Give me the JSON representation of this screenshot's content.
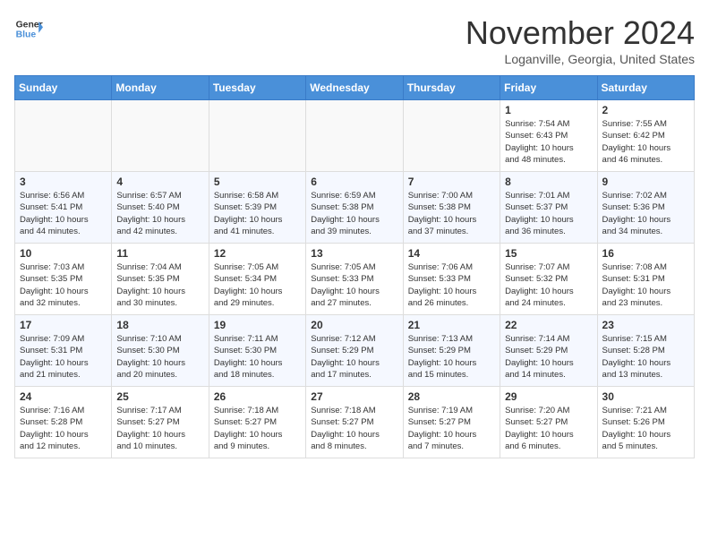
{
  "header": {
    "logo_line1": "General",
    "logo_line2": "Blue",
    "month": "November 2024",
    "location": "Loganville, Georgia, United States"
  },
  "weekdays": [
    "Sunday",
    "Monday",
    "Tuesday",
    "Wednesday",
    "Thursday",
    "Friday",
    "Saturday"
  ],
  "weeks": [
    [
      {
        "day": "",
        "info": ""
      },
      {
        "day": "",
        "info": ""
      },
      {
        "day": "",
        "info": ""
      },
      {
        "day": "",
        "info": ""
      },
      {
        "day": "",
        "info": ""
      },
      {
        "day": "1",
        "info": "Sunrise: 7:54 AM\nSunset: 6:43 PM\nDaylight: 10 hours\nand 48 minutes."
      },
      {
        "day": "2",
        "info": "Sunrise: 7:55 AM\nSunset: 6:42 PM\nDaylight: 10 hours\nand 46 minutes."
      }
    ],
    [
      {
        "day": "3",
        "info": "Sunrise: 6:56 AM\nSunset: 5:41 PM\nDaylight: 10 hours\nand 44 minutes."
      },
      {
        "day": "4",
        "info": "Sunrise: 6:57 AM\nSunset: 5:40 PM\nDaylight: 10 hours\nand 42 minutes."
      },
      {
        "day": "5",
        "info": "Sunrise: 6:58 AM\nSunset: 5:39 PM\nDaylight: 10 hours\nand 41 minutes."
      },
      {
        "day": "6",
        "info": "Sunrise: 6:59 AM\nSunset: 5:38 PM\nDaylight: 10 hours\nand 39 minutes."
      },
      {
        "day": "7",
        "info": "Sunrise: 7:00 AM\nSunset: 5:38 PM\nDaylight: 10 hours\nand 37 minutes."
      },
      {
        "day": "8",
        "info": "Sunrise: 7:01 AM\nSunset: 5:37 PM\nDaylight: 10 hours\nand 36 minutes."
      },
      {
        "day": "9",
        "info": "Sunrise: 7:02 AM\nSunset: 5:36 PM\nDaylight: 10 hours\nand 34 minutes."
      }
    ],
    [
      {
        "day": "10",
        "info": "Sunrise: 7:03 AM\nSunset: 5:35 PM\nDaylight: 10 hours\nand 32 minutes."
      },
      {
        "day": "11",
        "info": "Sunrise: 7:04 AM\nSunset: 5:35 PM\nDaylight: 10 hours\nand 30 minutes."
      },
      {
        "day": "12",
        "info": "Sunrise: 7:05 AM\nSunset: 5:34 PM\nDaylight: 10 hours\nand 29 minutes."
      },
      {
        "day": "13",
        "info": "Sunrise: 7:05 AM\nSunset: 5:33 PM\nDaylight: 10 hours\nand 27 minutes."
      },
      {
        "day": "14",
        "info": "Sunrise: 7:06 AM\nSunset: 5:33 PM\nDaylight: 10 hours\nand 26 minutes."
      },
      {
        "day": "15",
        "info": "Sunrise: 7:07 AM\nSunset: 5:32 PM\nDaylight: 10 hours\nand 24 minutes."
      },
      {
        "day": "16",
        "info": "Sunrise: 7:08 AM\nSunset: 5:31 PM\nDaylight: 10 hours\nand 23 minutes."
      }
    ],
    [
      {
        "day": "17",
        "info": "Sunrise: 7:09 AM\nSunset: 5:31 PM\nDaylight: 10 hours\nand 21 minutes."
      },
      {
        "day": "18",
        "info": "Sunrise: 7:10 AM\nSunset: 5:30 PM\nDaylight: 10 hours\nand 20 minutes."
      },
      {
        "day": "19",
        "info": "Sunrise: 7:11 AM\nSunset: 5:30 PM\nDaylight: 10 hours\nand 18 minutes."
      },
      {
        "day": "20",
        "info": "Sunrise: 7:12 AM\nSunset: 5:29 PM\nDaylight: 10 hours\nand 17 minutes."
      },
      {
        "day": "21",
        "info": "Sunrise: 7:13 AM\nSunset: 5:29 PM\nDaylight: 10 hours\nand 15 minutes."
      },
      {
        "day": "22",
        "info": "Sunrise: 7:14 AM\nSunset: 5:29 PM\nDaylight: 10 hours\nand 14 minutes."
      },
      {
        "day": "23",
        "info": "Sunrise: 7:15 AM\nSunset: 5:28 PM\nDaylight: 10 hours\nand 13 minutes."
      }
    ],
    [
      {
        "day": "24",
        "info": "Sunrise: 7:16 AM\nSunset: 5:28 PM\nDaylight: 10 hours\nand 12 minutes."
      },
      {
        "day": "25",
        "info": "Sunrise: 7:17 AM\nSunset: 5:27 PM\nDaylight: 10 hours\nand 10 minutes."
      },
      {
        "day": "26",
        "info": "Sunrise: 7:18 AM\nSunset: 5:27 PM\nDaylight: 10 hours\nand 9 minutes."
      },
      {
        "day": "27",
        "info": "Sunrise: 7:18 AM\nSunset: 5:27 PM\nDaylight: 10 hours\nand 8 minutes."
      },
      {
        "day": "28",
        "info": "Sunrise: 7:19 AM\nSunset: 5:27 PM\nDaylight: 10 hours\nand 7 minutes."
      },
      {
        "day": "29",
        "info": "Sunrise: 7:20 AM\nSunset: 5:27 PM\nDaylight: 10 hours\nand 6 minutes."
      },
      {
        "day": "30",
        "info": "Sunrise: 7:21 AM\nSunset: 5:26 PM\nDaylight: 10 hours\nand 5 minutes."
      }
    ]
  ]
}
